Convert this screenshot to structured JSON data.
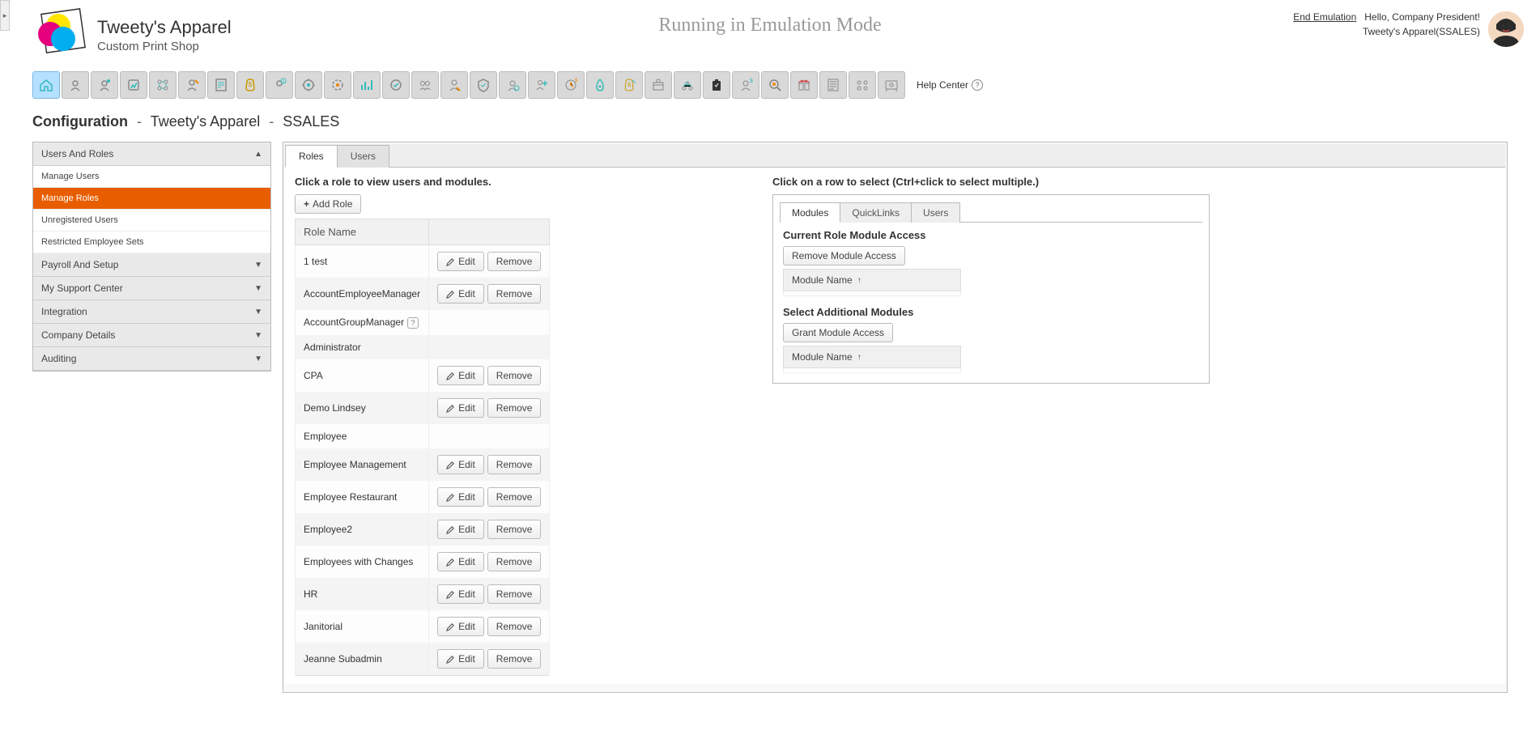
{
  "header": {
    "company": "Tweety's Apparel",
    "subtitle": "Custom Print Shop",
    "banner": "Running in Emulation Mode",
    "end_emulation": "End Emulation",
    "greeting": "Hello, Company President!",
    "company_line": "Tweety's Apparel(SSALES)"
  },
  "help_center": "Help Center",
  "breadcrumb": {
    "main": "Configuration",
    "company": "Tweety's Apparel",
    "code": "SSALES"
  },
  "sidebar": {
    "sections": [
      {
        "title": "Users And Roles",
        "expanded": true,
        "items": [
          "Manage Users",
          "Manage Roles",
          "Unregistered Users",
          "Restricted Employee Sets"
        ],
        "selected": 1
      },
      {
        "title": "Payroll And Setup",
        "expanded": false
      },
      {
        "title": "My Support Center",
        "expanded": false
      },
      {
        "title": "Integration",
        "expanded": false
      },
      {
        "title": "Company Details",
        "expanded": false
      },
      {
        "title": "Auditing",
        "expanded": false
      }
    ]
  },
  "tabs": {
    "roles": "Roles",
    "users": "Users"
  },
  "left": {
    "instruction": "Click a role to view users and modules.",
    "add_role": "Add Role",
    "header": "Role Name",
    "edit": "Edit",
    "remove": "Remove",
    "roles": [
      {
        "name": "1 test",
        "edit": true,
        "remove": true
      },
      {
        "name": "AccountEmployeeManager",
        "edit": true,
        "remove": true
      },
      {
        "name": "AccountGroupManager",
        "help": true
      },
      {
        "name": "Administrator"
      },
      {
        "name": "CPA",
        "edit": true,
        "remove": true
      },
      {
        "name": "Demo Lindsey",
        "edit": true,
        "remove": true
      },
      {
        "name": "Employee"
      },
      {
        "name": "Employee Management",
        "edit": true,
        "remove": true
      },
      {
        "name": "Employee Restaurant",
        "edit": true,
        "remove": true
      },
      {
        "name": "Employee2",
        "edit": true,
        "remove": true
      },
      {
        "name": "Employees with Changes",
        "edit": true,
        "remove": true
      },
      {
        "name": "HR",
        "edit": true,
        "remove": true
      },
      {
        "name": "Janitorial",
        "edit": true,
        "remove": true
      },
      {
        "name": "Jeanne Subadmin",
        "edit": true,
        "remove": true
      }
    ]
  },
  "right": {
    "instruction": "Click on a row to select (Ctrl+click to select multiple.)",
    "subtabs": {
      "modules": "Modules",
      "quicklinks": "QuickLinks",
      "users": "Users"
    },
    "section1_title": "Current Role Module Access",
    "remove_access": "Remove Module Access",
    "module_name": "Module Name",
    "section2_title": "Select Additional Modules",
    "grant_access": "Grant Module Access"
  },
  "toolbar_count": 30
}
